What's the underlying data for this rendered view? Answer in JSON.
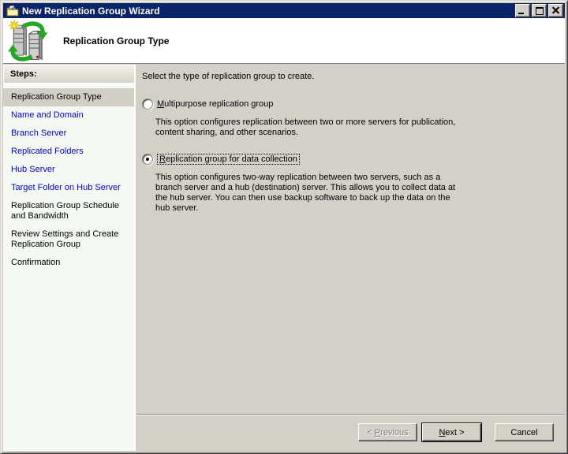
{
  "window": {
    "title": "New Replication Group Wizard",
    "titlebar_icons": [
      "wizard-folder-icon",
      "minimize-icon",
      "maximize-icon",
      "close-icon"
    ]
  },
  "header": {
    "title": "Replication Group Type",
    "icon": "replication-servers-icon"
  },
  "steps_panel": {
    "title": "Steps:",
    "items": [
      {
        "label": "Replication Group Type",
        "state": "current"
      },
      {
        "label": "Name and Domain",
        "state": "link"
      },
      {
        "label": "Branch Server",
        "state": "link"
      },
      {
        "label": "Replicated Folders",
        "state": "link"
      },
      {
        "label": "Hub Server",
        "state": "link"
      },
      {
        "label": "Target Folder on Hub Server",
        "state": "link"
      },
      {
        "label": "Replication Group Schedule and Bandwidth",
        "state": "future"
      },
      {
        "label": "Review Settings and Create Replication Group",
        "state": "future"
      },
      {
        "label": "Confirmation",
        "state": "future"
      }
    ]
  },
  "main": {
    "prompt": "Select the type of replication group to create.",
    "options": [
      {
        "label": "Multipurpose replication group",
        "mnemonic": "M",
        "label_rest": "ultipurpose replication group",
        "selected": false,
        "description": "This option configures replication between two or more servers for publication, content sharing, and other scenarios."
      },
      {
        "label": "Replication group for data collection",
        "mnemonic": "R",
        "label_rest": "eplication group for data collection",
        "selected": true,
        "focused": true,
        "description": "This option configures two-way replication between two servers, such as a branch server and a hub (destination) server. This allows you to collect data at the hub server. You can then use backup software to back up the data on the hub server."
      }
    ]
  },
  "footer": {
    "buttons": [
      {
        "label": "< Previous",
        "pre": "< ",
        "mnemonic": "P",
        "rest": "revious",
        "enabled": false
      },
      {
        "label": "Next >",
        "pre": "",
        "mnemonic": "N",
        "rest": "ext >",
        "enabled": true,
        "default": true
      },
      {
        "label": "Cancel",
        "enabled": true
      }
    ]
  },
  "colors": {
    "titlebar": "#0a246a",
    "face": "#d4d0c8",
    "steps_panel_bg": "#f5faf5",
    "step_link": "#0000d8",
    "selected_step_bg": "#d2cfc7",
    "arrow_green": "#22a822"
  }
}
